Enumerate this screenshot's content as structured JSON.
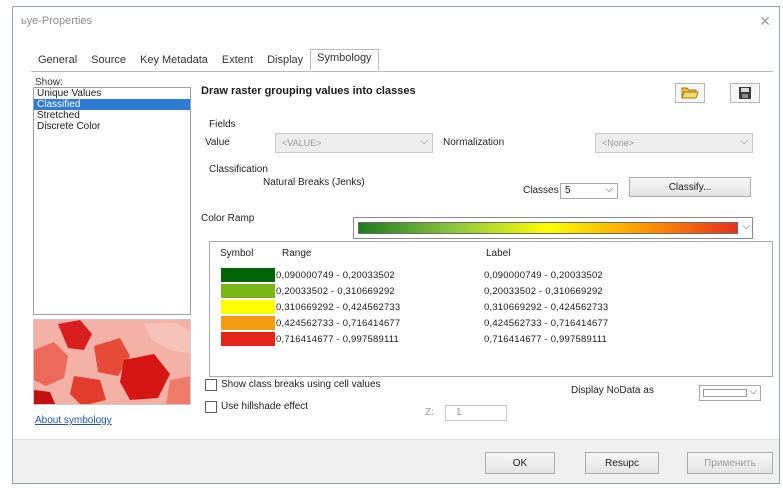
{
  "window": {
    "title": "ьуе-Properties",
    "close_symbol": "✕"
  },
  "tabs": [
    {
      "label": "General"
    },
    {
      "label": "Source"
    },
    {
      "label": "Key Metadata"
    },
    {
      "label": "Extent"
    },
    {
      "label": "Display"
    },
    {
      "label": "Symbology",
      "active": true
    }
  ],
  "show": {
    "label": "Show:",
    "items": [
      {
        "label": "Unique Values"
      },
      {
        "label": "Classified",
        "selected": true
      },
      {
        "label": "Stretched"
      },
      {
        "label": "Discrete Color"
      }
    ]
  },
  "main": {
    "title": "Draw raster grouping values into classes",
    "open_icon": "folder-open-icon",
    "save_icon": "save-icon"
  },
  "fields": {
    "group_label": "Fields",
    "value_label": "Value",
    "value_selected": "<VALUE>",
    "normalization_label": "Normalization",
    "normalization_selected": "<None>"
  },
  "classification": {
    "group_label": "Classification",
    "method": "Natural Breaks (Jenks)",
    "classes_label": "Classes",
    "classes_value": "5",
    "classify_button": "Classify..."
  },
  "color_ramp": {
    "label": "Color Ramp",
    "colors": [
      "#1e7a1e",
      "#8cc63f",
      "#ffff00",
      "#ff9900",
      "#e8301c"
    ]
  },
  "table": {
    "headers": {
      "symbol": "Symbol",
      "range": "Range",
      "label": "Label"
    },
    "rows": [
      {
        "color": "#006400",
        "range": "0,090000749 - 0,20033502",
        "label": "0,090000749 - 0,20033502"
      },
      {
        "color": "#7cb518",
        "range": "0,20033502 - 0,310669292",
        "label": "0,20033502 - 0,310669292"
      },
      {
        "color": "#ffff00",
        "range": "0,310669292 - 0,424562733",
        "label": "0,310669292 - 0,424562733"
      },
      {
        "color": "#f39c12",
        "range": "0,424562733 - 0,716414677",
        "label": "0,424562733 - 0,716414677"
      },
      {
        "color": "#e8231a",
        "range": "0,716414677 - 0,997589111",
        "label": "0,716414677 - 0,997589111"
      }
    ]
  },
  "options": {
    "show_breaks_label": "Show class breaks using cell values",
    "hillshade_label": "Use hillshade effect",
    "z_label": "Z:",
    "z_value": "1",
    "nodata_label": "Display NoData as"
  },
  "about_link": "About symbology",
  "footer": {
    "ok": "OK",
    "cancel": "Resupc",
    "apply": "Применить"
  }
}
